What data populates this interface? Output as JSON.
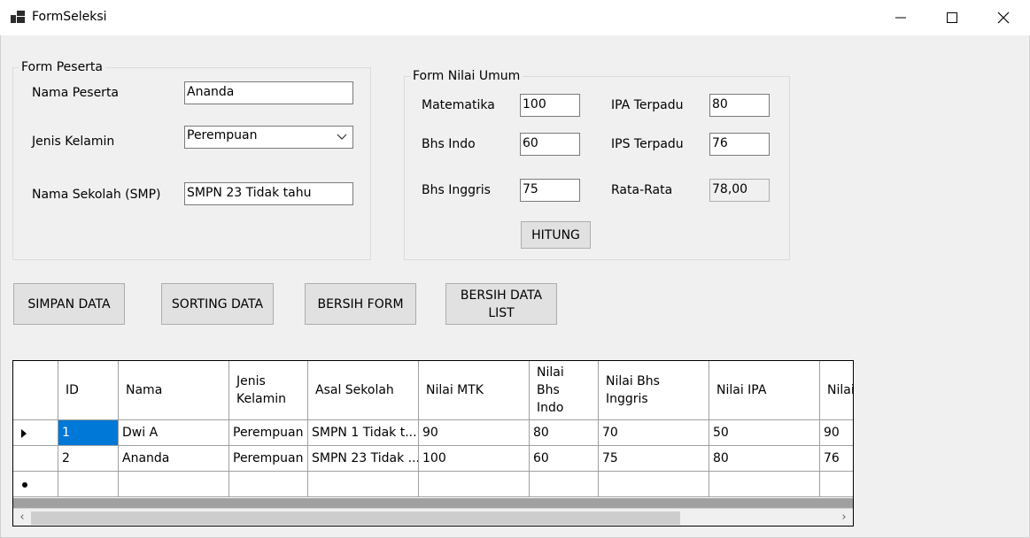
{
  "window": {
    "title": "FormSeleksi"
  },
  "form_peserta": {
    "group_title": "Form Peserta",
    "nama_label": "Nama Peserta",
    "nama_value": "Ananda",
    "kelamin_label": "Jenis Kelamin",
    "kelamin_value": "Perempuan",
    "sekolah_label": "Nama Sekolah (SMP)",
    "sekolah_value": "SMPN 23 Tidak tahu"
  },
  "form_nilai": {
    "group_title": "Form Nilai Umum",
    "mtk_label": "Matematika",
    "mtk_value": "100",
    "indo_label": "Bhs Indo",
    "indo_value": "60",
    "inggris_label": "Bhs Inggris",
    "inggris_value": "75",
    "ipa_label": "IPA Terpadu",
    "ipa_value": "80",
    "ips_label": "IPS Terpadu",
    "ips_value": "76",
    "rata_label": "Rata-Rata",
    "rata_value": "78,00",
    "hitung_label": "HITUNG"
  },
  "actions": {
    "simpan": "SIMPAN DATA",
    "sorting": "SORTING DATA",
    "bersih_form": "BERSIH FORM",
    "bersih_list": "BERSIH DATA\nLIST"
  },
  "grid": {
    "columns": [
      "ID",
      "Nama",
      "Jenis\nKelamin",
      "Asal Sekolah",
      "Nilai MTK",
      "Nilai\nBhs\nIndo",
      "Nilai Bhs\nInggris",
      "Nilai IPA",
      "Nilai"
    ],
    "rows": [
      [
        "1",
        "Dwi A",
        "Perempuan",
        "SMPN 1 Tidak t...",
        "90",
        "80",
        "70",
        "50",
        "90"
      ],
      [
        "2",
        "Ananda",
        "Perempuan",
        "SMPN 23 Tidak ...",
        "100",
        "60",
        "75",
        "80",
        "76"
      ]
    ]
  },
  "icons": {
    "app": "app-window-icon",
    "minimize": "minimize-icon",
    "maximize": "maximize-icon",
    "close": "close-icon",
    "dropdown": "chevron-down-icon",
    "row_current": "row-pointer-icon",
    "row_new": "new-row-icon",
    "scroll_left": "chevron-left-icon",
    "scroll_right": "chevron-right-icon"
  },
  "colors": {
    "selection": "#0078d7",
    "button": "#e1e1e1",
    "background": "#f0f0f0"
  }
}
